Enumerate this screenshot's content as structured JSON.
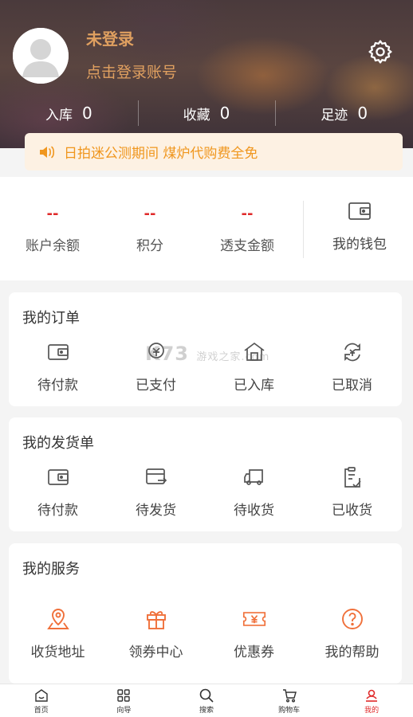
{
  "user": {
    "name": "未登录",
    "login_hint": "点击登录账号"
  },
  "stats": [
    {
      "label": "入库",
      "value": "0"
    },
    {
      "label": "收藏",
      "value": "0"
    },
    {
      "label": "足迹",
      "value": "0"
    }
  ],
  "notice": {
    "text": "日拍迷公测期间 煤炉代购费全免",
    "icon": "speaker-icon"
  },
  "wallet": {
    "items": [
      {
        "value": "--",
        "label": "账户余额"
      },
      {
        "value": "--",
        "label": "积分"
      },
      {
        "value": "--",
        "label": "透支金额"
      }
    ],
    "my_wallet": "我的钱包"
  },
  "orders": {
    "title": "我的订单",
    "items": [
      {
        "label": "待付款",
        "icon": "wallet-icon"
      },
      {
        "label": "已支付",
        "icon": "paid-icon"
      },
      {
        "label": "已入库",
        "icon": "warehouse-icon"
      },
      {
        "label": "已取消",
        "icon": "cancel-icon"
      }
    ]
  },
  "shipments": {
    "title": "我的发货单",
    "items": [
      {
        "label": "待付款",
        "icon": "wallet-icon"
      },
      {
        "label": "待发货",
        "icon": "to-ship-icon"
      },
      {
        "label": "待收货",
        "icon": "truck-icon"
      },
      {
        "label": "已收货",
        "icon": "clipboard-check-icon"
      }
    ]
  },
  "services": {
    "title": "我的服务",
    "items": [
      {
        "label": "收货地址",
        "icon": "map-pin-icon"
      },
      {
        "label": "领券中心",
        "icon": "gift-icon"
      },
      {
        "label": "优惠券",
        "icon": "coupon-icon"
      },
      {
        "label": "我的帮助",
        "icon": "help-icon"
      }
    ]
  },
  "watermark": {
    "main": "K73",
    "sub": "游戏之家",
    "domain": ".com"
  },
  "nav": [
    {
      "label": "首页",
      "icon": "home-icon"
    },
    {
      "label": "向导",
      "icon": "grid-icon"
    },
    {
      "label": "搜索",
      "icon": "search-icon"
    },
    {
      "label": "购物车",
      "icon": "cart-icon"
    },
    {
      "label": "我的",
      "icon": "profile-icon",
      "active": true
    }
  ],
  "colors": {
    "accent": "#e02a2a",
    "service_icon": "#f0703a",
    "gold": "#e0a060",
    "notice_text": "#f0961e"
  }
}
